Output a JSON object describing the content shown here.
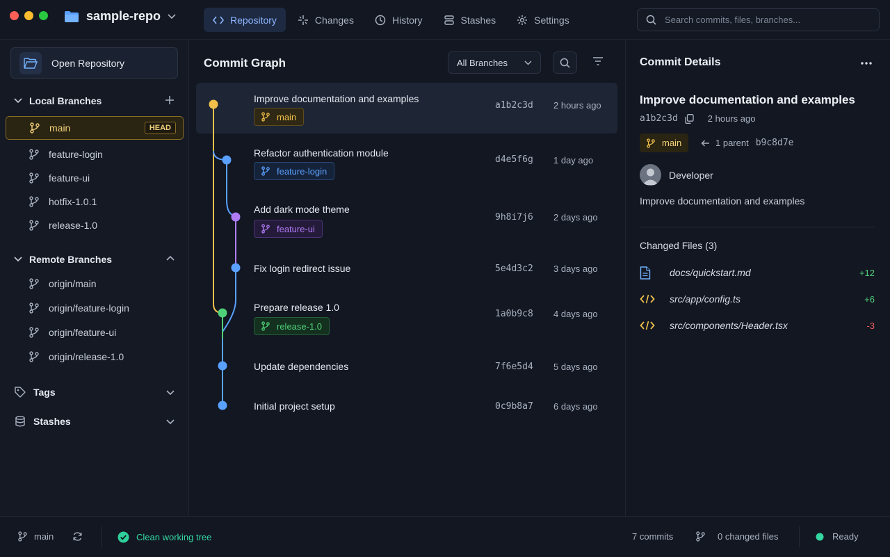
{
  "window": {
    "repo_name": "sample-repo",
    "traffic_colors": [
      "#ff5f57",
      "#febc2e",
      "#28c840"
    ]
  },
  "nav": {
    "tabs": [
      {
        "label": "Repository",
        "icon": "code-icon",
        "active": true
      },
      {
        "label": "Changes",
        "icon": "sparkle-icon",
        "active": false
      },
      {
        "label": "History",
        "icon": "clock-icon",
        "active": false
      },
      {
        "label": "Stashes",
        "icon": "stack-icon",
        "active": false
      },
      {
        "label": "Settings",
        "icon": "gear-icon",
        "active": false
      }
    ],
    "search_placeholder": "Search commits, files, branches..."
  },
  "sidebar": {
    "open_repository": "Open Repository",
    "local_branches": {
      "title": "Local Branches",
      "items": [
        "main",
        "feature-login",
        "feature-ui",
        "hotfix-1.0.1",
        "release-1.0"
      ],
      "active": "main",
      "head_badge": "HEAD"
    },
    "remote_branches": {
      "title": "Remote Branches",
      "items": [
        "origin/main",
        "origin/feature-login",
        "origin/feature-ui",
        "origin/release-1.0"
      ]
    },
    "tags": "Tags",
    "stashes": "Stashes"
  },
  "graph": {
    "title": "Commit Graph",
    "branch_filter": "All Branches",
    "commits": [
      {
        "message": "Improve documentation and examples",
        "hash": "a1b2c3d",
        "time": "2 hours ago",
        "branch": "main",
        "branch_color": "#f0c04a",
        "selected": true
      },
      {
        "message": "Refactor authentication module",
        "hash": "d4e5f6g",
        "time": "1 day ago",
        "branch": "feature-login",
        "branch_color": "#5aa0ff",
        "selected": false
      },
      {
        "message": "Add dark mode theme",
        "hash": "9h8i7j6",
        "time": "2 days ago",
        "branch": "feature-ui",
        "branch_color": "#b07cf5",
        "selected": false
      },
      {
        "message": "Fix login redirect issue",
        "hash": "5e4d3c2",
        "time": "3 days ago",
        "branch": "",
        "branch_color": "#5aa0ff",
        "selected": false
      },
      {
        "message": "Prepare release 1.0",
        "hash": "1a0b9c8",
        "time": "4 days ago",
        "branch": "release-1.0",
        "branch_color": "#4fd17a",
        "selected": false
      },
      {
        "message": "Update dependencies",
        "hash": "7f6e5d4",
        "time": "5 days ago",
        "branch": "",
        "branch_color": "#5aa0ff",
        "selected": false
      },
      {
        "message": "Initial project setup",
        "hash": "0c9b8a7",
        "time": "6 days ago",
        "branch": "",
        "branch_color": "#5aa0ff",
        "selected": false
      }
    ]
  },
  "details": {
    "title": "Commit Details",
    "commit_title": "Improve documentation and examples",
    "hash": "a1b2c3d",
    "time": "2 hours ago",
    "branch": "main",
    "parent_label": "1 parent",
    "parent_hash": "b9c8d7e",
    "author": "Developer",
    "description": "Improve documentation and examples",
    "changed_files_label": "Changed Files (3)",
    "files": [
      {
        "path": "docs/quickstart.md",
        "delta": "+12",
        "icon": "document-icon",
        "kind": "add"
      },
      {
        "path": "src/app/config.ts",
        "delta": "+6",
        "icon": "code-file-icon",
        "kind": "add"
      },
      {
        "path": "src/components/Header.tsx",
        "delta": "-3",
        "icon": "code-file-icon",
        "kind": "del"
      }
    ]
  },
  "status": {
    "branch": "main",
    "working_tree": "Clean working tree",
    "commits": "7 commits",
    "changed_files": "0 changed files",
    "state": "Ready"
  },
  "colors": {
    "accent": "#8fb6ff",
    "main": "#f0c04a",
    "feature_login": "#5aa0ff",
    "feature_ui": "#b07cf5",
    "release": "#4fd17a",
    "added": "#4fd17a",
    "deleted": "#ef5a5a"
  }
}
